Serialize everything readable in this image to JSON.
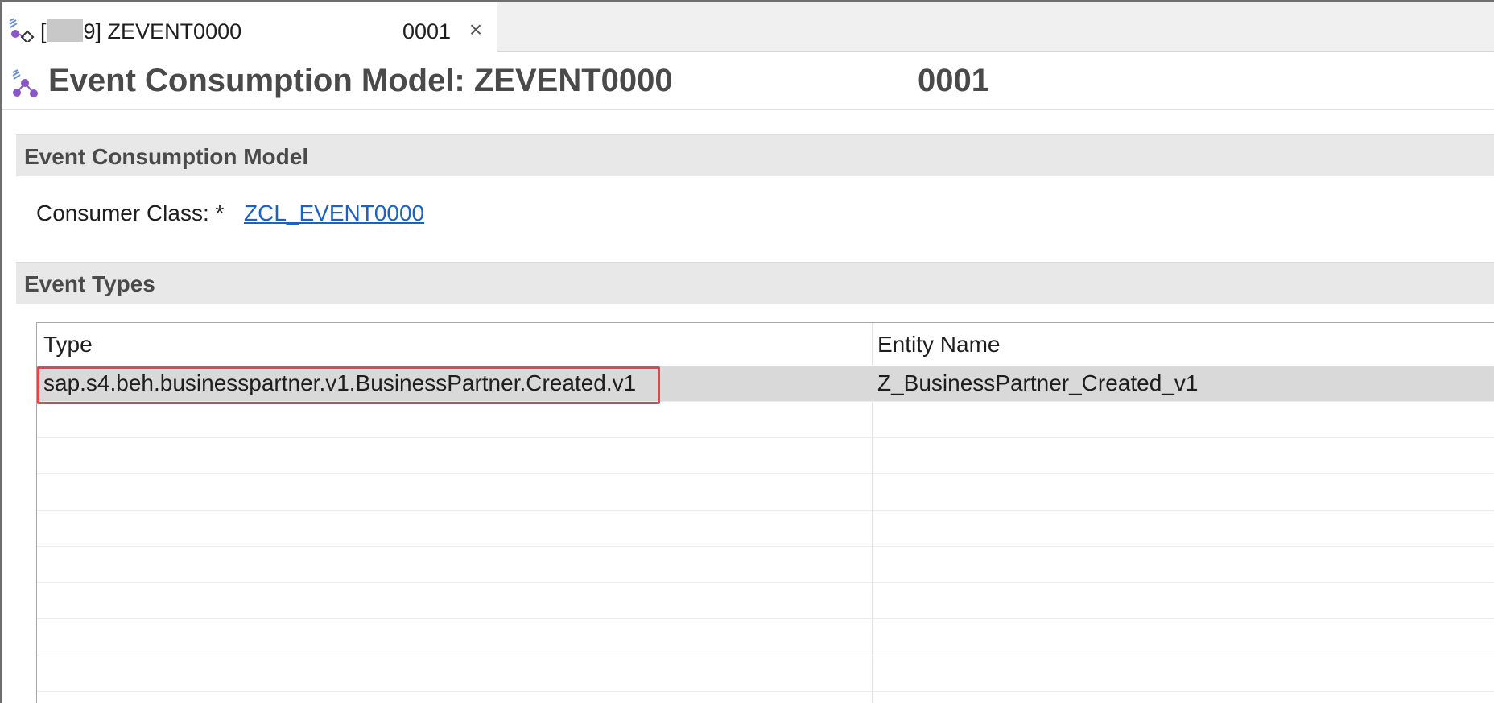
{
  "tab": {
    "bracket_open": "[",
    "bracket_close": "9] ",
    "object_name": "ZEVENT0000",
    "suffix": "0001",
    "close_glyph": "×"
  },
  "header": {
    "title": "Event Consumption Model: ZEVENT0000",
    "suffix": "0001"
  },
  "sections": {
    "model_heading": "Event Consumption Model",
    "event_types_heading": "Event Types"
  },
  "consumer": {
    "label": "Consumer Class: *",
    "value": "ZCL_EVENT0000"
  },
  "table": {
    "columns": [
      "Type",
      "Entity Name"
    ],
    "rows": [
      {
        "type": "sap.s4.beh.businesspartner.v1.BusinessPartner.Created.v1",
        "entity": "Z_BusinessPartner_Created_v1"
      }
    ]
  },
  "icons": {
    "tab": "event-model-icon",
    "header": "event-model-icon",
    "close": "close-icon"
  },
  "colors": {
    "link": "#1a62c7",
    "highlight": "#e0474c",
    "selected_row": "#d9d9d9",
    "section_header": "#e8e8e8"
  }
}
